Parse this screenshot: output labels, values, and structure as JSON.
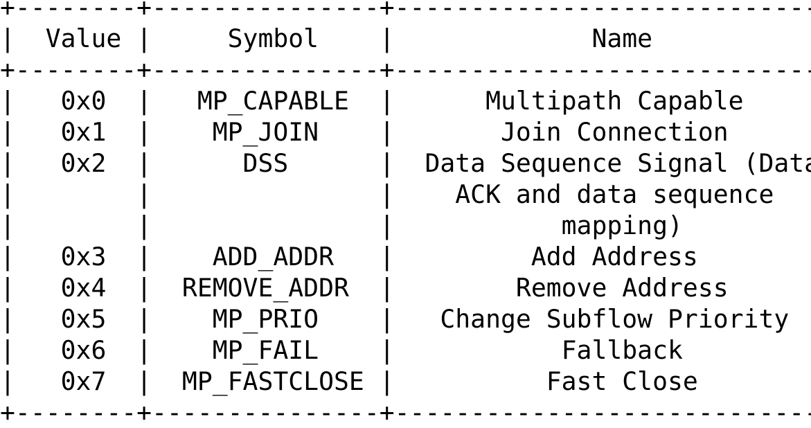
{
  "table": {
    "header": {
      "value": "Value",
      "symbol": "Symbol",
      "name": "Name"
    },
    "rows": [
      {
        "value": "0x0",
        "symbol": "MP_CAPABLE",
        "name": [
          "Multipath Capable"
        ]
      },
      {
        "value": "0x1",
        "symbol": "MP_JOIN",
        "name": [
          "Join Connection"
        ]
      },
      {
        "value": "0x2",
        "symbol": "DSS",
        "name": [
          "Data Sequence Signal (Data",
          "ACK and data sequence",
          "mapping)"
        ]
      },
      {
        "value": "0x3",
        "symbol": "ADD_ADDR",
        "name": [
          "Add Address"
        ]
      },
      {
        "value": "0x4",
        "symbol": "REMOVE_ADDR",
        "name": [
          "Remove Address"
        ]
      },
      {
        "value": "0x5",
        "symbol": "MP_PRIO",
        "name": [
          "Change Subflow Priority"
        ]
      },
      {
        "value": "0x6",
        "symbol": "MP_FAIL",
        "name": [
          "Fallback"
        ]
      },
      {
        "value": "0x7",
        "symbol": "MP_FASTCLOSE",
        "name": [
          "Fast Close"
        ]
      }
    ]
  }
}
